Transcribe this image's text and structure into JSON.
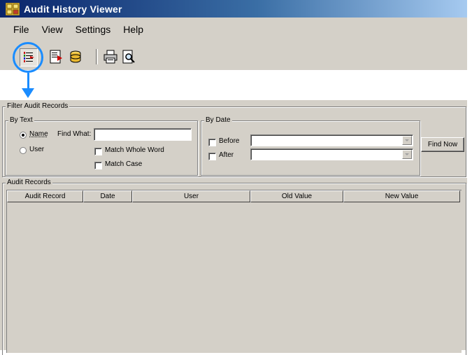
{
  "window": {
    "title": "Audit History Viewer"
  },
  "menu": [
    "File",
    "View",
    "Settings",
    "Help"
  ],
  "toolbar": {
    "buttons": [
      {
        "icon": "filter-list-icon",
        "pressed": true
      },
      {
        "icon": "export-report-icon",
        "pressed": false
      },
      {
        "icon": "database-icon",
        "pressed": false
      },
      {
        "icon": "printer-icon",
        "pressed": false
      },
      {
        "icon": "print-preview-icon",
        "pressed": false
      }
    ]
  },
  "highlight": {
    "color": "#1a8cff"
  },
  "filter": {
    "group_label": "Filter Audit Records",
    "by_text": {
      "label": "By Text",
      "name_option": "Name",
      "user_option": "User",
      "selected": "Name",
      "find_what_label": "Find What:",
      "find_what_value": "",
      "match_whole_word": "Match Whole Word",
      "match_case": "Match Case"
    },
    "by_date": {
      "label": "By Date",
      "before": "Before",
      "after": "After",
      "before_value": "",
      "after_value": ""
    },
    "find_now": "Find Now"
  },
  "records": {
    "group_label": "Audit Records",
    "columns": [
      "Audit Record",
      "Date",
      "User",
      "Old Value",
      "New Value"
    ],
    "rows": []
  }
}
